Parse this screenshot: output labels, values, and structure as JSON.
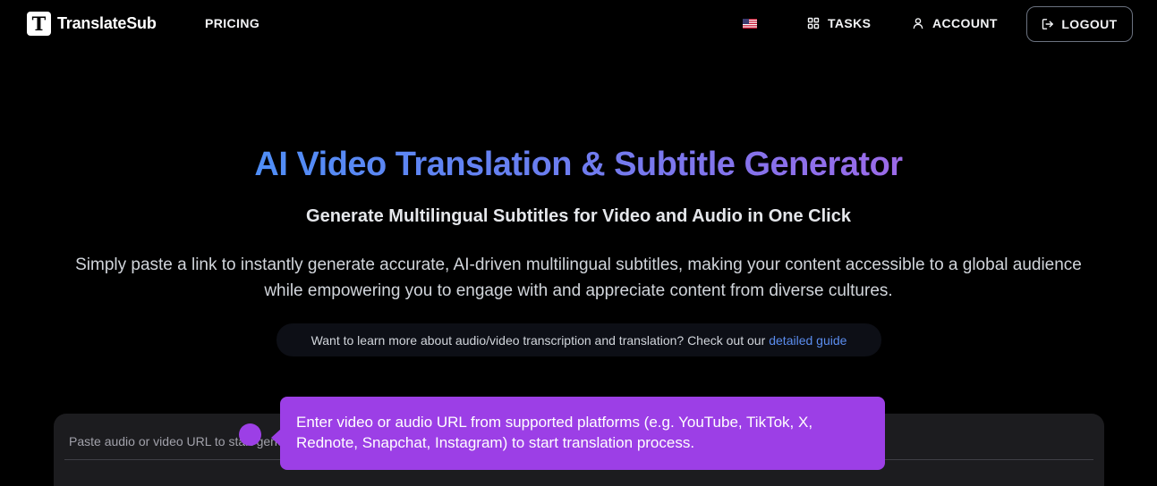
{
  "nav": {
    "logo_letter": "T",
    "logo_text": "TranslateSub",
    "pricing": "PRICING",
    "language_flag": "us-flag-icon",
    "tasks": "TASKS",
    "account": "ACCOUNT",
    "logout": "LOGOUT"
  },
  "hero": {
    "title": "AI Video Translation & Subtitle Generator",
    "subtitle": "Generate Multilingual Subtitles for Video and Audio in One Click",
    "description_line1": "Simply paste a link to instantly generate accurate, AI-driven multilingual subtitles, making your content accessible to a global audience",
    "description_line2": "while empowering you to engage with and appreciate content from diverse cultures.",
    "guide_text": "Want to learn more about audio/video transcription and translation? Check out our",
    "guide_link": "detailed guide"
  },
  "input": {
    "placeholder": "Paste audio or video URL to start generating subtitles",
    "value": ""
  },
  "tooltip": {
    "line1": "Enter video or audio URL from supported platforms (e.g. YouTube, TikTok, X,",
    "line2": "Rednote, Snapchat, Instagram) to start translation process."
  },
  "colors": {
    "background": "#000000",
    "tooltip": "#9c3fe6",
    "link": "#5b8def",
    "gradient_start": "#4f8ef7",
    "gradient_end": "#9b6ae8"
  }
}
